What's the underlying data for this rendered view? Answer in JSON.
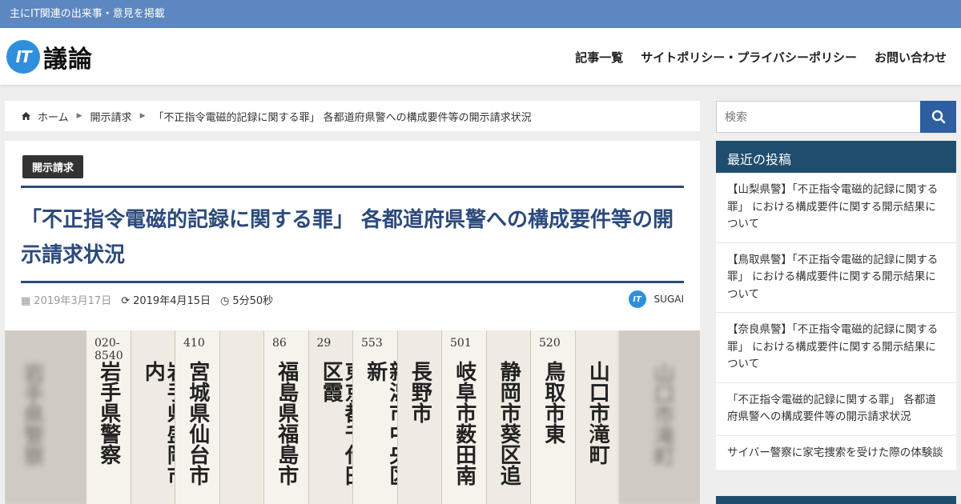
{
  "topbar": {
    "tagline": "主にIT関連の出来事・意見を掲載"
  },
  "header": {
    "logo_mark": "IT",
    "logo_text": "議論",
    "nav": [
      "記事一覧",
      "サイトポリシー・プライバシーポリシー",
      "お問い合わせ"
    ]
  },
  "breadcrumb": {
    "home": "ホーム",
    "category": "開示請求",
    "current": "「不正指令電磁的記録に関する罪」 各都道府県警への構成要件等の開示請求状況"
  },
  "article": {
    "category": "開示請求",
    "title": "「不正指令電磁的記録に関する罪」 各都道府県警への構成要件等の開示請求状況",
    "published": "2019年3月17日",
    "updated": "2019年4月15日",
    "reading_time": "5分50秒",
    "author": "SUGAI",
    "author_mark": "IT"
  },
  "hero": {
    "envelopes": [
      {
        "num": "020-8540",
        "text": "岩手県警察"
      },
      {
        "num": "",
        "text": "岩手県盛岡市内"
      },
      {
        "num": "410",
        "text": "宮城県仙台市"
      },
      {
        "num": "",
        "text": ""
      },
      {
        "num": "86",
        "text": "福島県福島市"
      },
      {
        "num": "29",
        "text": "東京都千代田区霞"
      },
      {
        "num": "553",
        "text": "新潟市中央区新"
      },
      {
        "num": "",
        "text": "長野市"
      },
      {
        "num": "501",
        "text": "岐阜市薮田南"
      },
      {
        "num": "",
        "text": "静岡市葵区追"
      },
      {
        "num": "520",
        "text": "鳥取市東"
      },
      {
        "num": "",
        "text": "山口市滝町"
      }
    ],
    "blur_left": "岩手県警察",
    "blur_right": "山口市滝町"
  },
  "sidebar": {
    "search_placeholder": "検索",
    "recent_title": "最近の投稿",
    "recent_posts": [
      "【山梨県警】「不正指令電磁的記録に関する罪」 における構成要件に関する開示結果について",
      "【鳥取県警】「不正指令電磁的記録に関する罪」 における構成要件に関する開示結果について",
      "【奈良県警】「不正指令電磁的記録に関する罪」 における構成要件に関する開示結果について",
      "「不正指令電磁的記録に関する罪」 各都道府県警への構成要件等の開示請求状況",
      "サイバー警察に家宅捜索を受けた際の体験談"
    ]
  },
  "colors": {
    "topbar": "#5d87c0",
    "title": "#2c4a7c",
    "sidebar_head": "#1f4d6d",
    "search_btn": "#2c5ea0"
  }
}
